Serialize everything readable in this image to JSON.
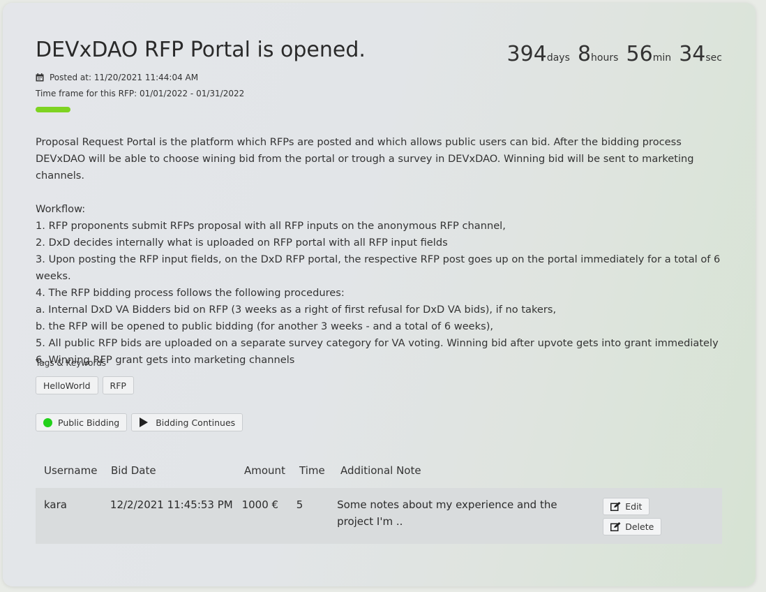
{
  "rfp": {
    "title": "DEVxDAO RFP Portal is opened.",
    "posted_label": "Posted at:",
    "posted_at": "11/20/2021 11:44:04 AM",
    "timeframe_label": "Time frame for this RFP:",
    "timeframe": "01/01/2022 - 01/31/2022",
    "progress_percent": 100
  },
  "countdown": {
    "days": "394",
    "days_unit": "days",
    "hours": "8",
    "hours_unit": "hours",
    "minutes": "56",
    "minutes_unit": "min",
    "seconds": "34",
    "seconds_unit": "sec"
  },
  "description": {
    "intro": "Proposal Request Portal is the platform which RFPs are posted and which allows public users can bid. After the bidding process DEVxDAO will be able to choose wining bid from the portal or trough a survey in DEVxDAO. Winning bid will be sent to marketing channels.",
    "workflow": [
      "Workflow:",
      "1. RFP proponents submit RFPs proposal with all RFP inputs on the anonymous RFP channel,",
      "2. DxD decides internally what is uploaded on RFP portal with all RFP input fields",
      "3. Upon posting the RFP input fields, on the DxD RFP portal, the respective RFP post goes up on the portal immediately for a total of 6 weeks.",
      "4. The RFP bidding process follows the following procedures:",
      "a. Internal DxD VA Bidders bid on RFP (3 weeks as a right of first refusal for DxD VA bids), if no takers,",
      "b. the RFP will be opened to public bidding (for another 3 weeks - and a total of 6 weeks),",
      "5. All public RFP bids are uploaded on a separate survey category for VA voting. Winning bid after upvote gets into grant immediately",
      "6. Winning RFP grant gets into marketing channels"
    ]
  },
  "tags": {
    "label": "Tags & Keywords",
    "items": [
      "HelloWorld",
      "RFP"
    ]
  },
  "status": {
    "bidding": "Public Bidding",
    "bidding_color": "#22d11a",
    "continues": "Bidding Continues"
  },
  "bids_table": {
    "headers": [
      "Username",
      "Bid Date",
      "Amount",
      "Time",
      "Additional Note"
    ],
    "rows": [
      {
        "username": "kara",
        "bid_date": "12/2/2021 11:45:53 PM",
        "amount": "1000 €",
        "time": "5",
        "note": "Some notes about my experience and the project I'm .."
      }
    ],
    "edit_label": "Edit",
    "delete_label": "Delete"
  },
  "colors": {
    "accent_green": "#7ed321",
    "row_background": "#d9dcdd"
  }
}
